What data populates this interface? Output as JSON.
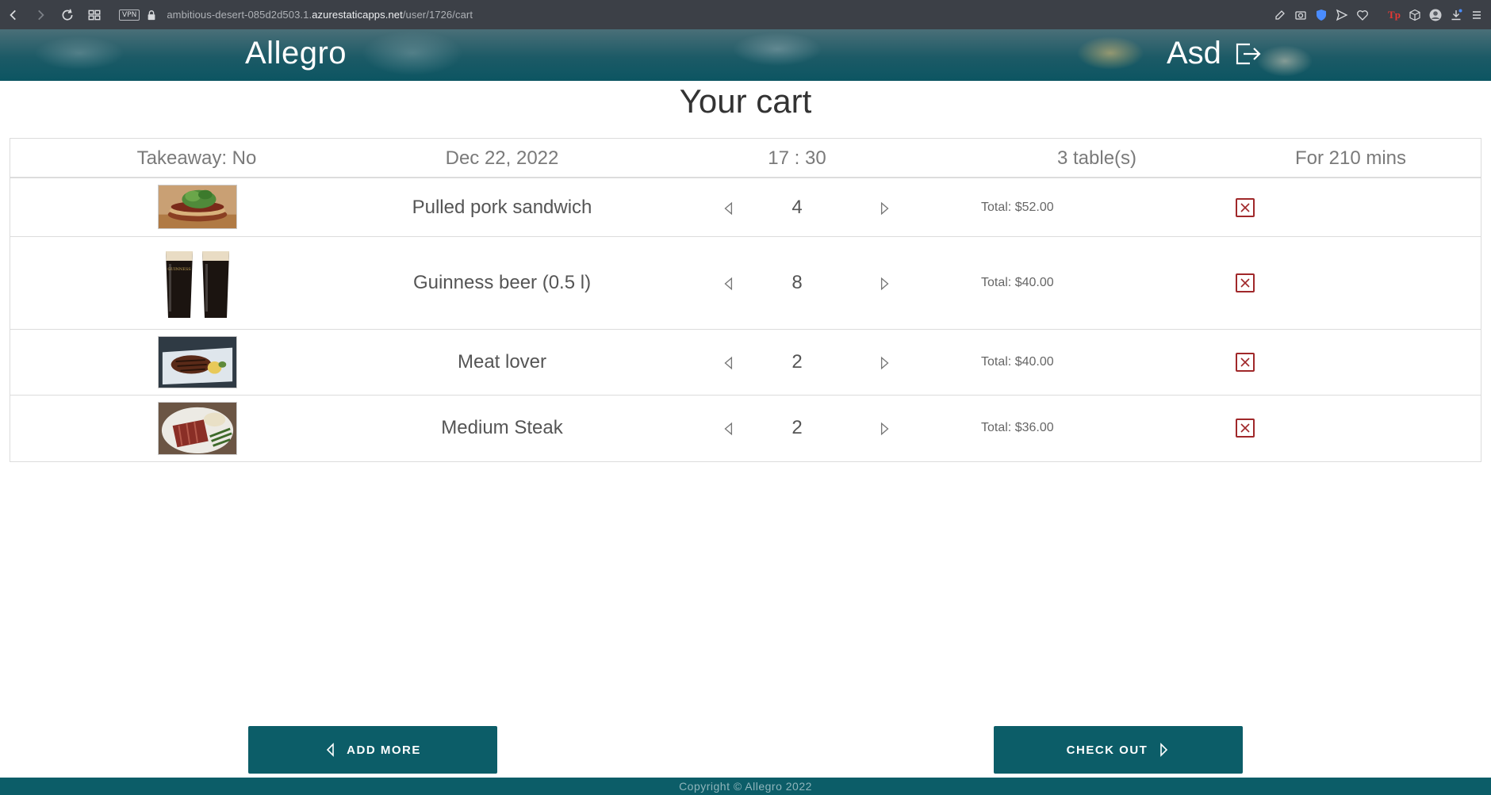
{
  "browser": {
    "url_prefix": "ambitious-desert-085d2d503.1.",
    "url_host": "azurestaticapps.net",
    "url_path": "/user/1726/cart",
    "vpn_label": "VPN"
  },
  "header": {
    "brand": "Allegro",
    "user_name": "Asd"
  },
  "page": {
    "title": "Your cart"
  },
  "reservation": {
    "takeaway": "Takeaway: No",
    "date": "Dec 22, 2022",
    "time": "17 : 30",
    "tables": "3 table(s)",
    "duration": "For 210 mins"
  },
  "items": [
    {
      "name": "Pulled pork sandwich",
      "quantity": "4",
      "total": "Total: $52.00",
      "image": "sandwich"
    },
    {
      "name": "Guinness beer (0.5 l)",
      "quantity": "8",
      "total": "Total: $40.00",
      "image": "beer"
    },
    {
      "name": "Meat lover",
      "quantity": "2",
      "total": "Total: $40.00",
      "image": "steak-plate"
    },
    {
      "name": "Medium Steak",
      "quantity": "2",
      "total": "Total: $36.00",
      "image": "steak-sliced"
    }
  ],
  "actions": {
    "add_more": "ADD MORE",
    "check_out": "CHECK OUT"
  },
  "footer": {
    "copyright": "Copyright © Allegro 2022"
  },
  "colors": {
    "primary": "#0c5d68",
    "remove": "#a0282a",
    "chrome": "#3c4047"
  }
}
